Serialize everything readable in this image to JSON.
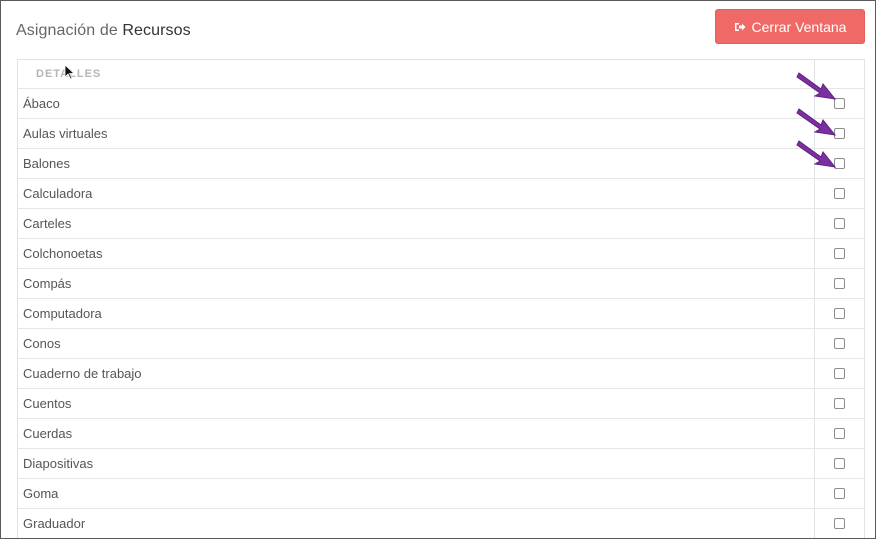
{
  "header": {
    "title_prefix": "Asignación de ",
    "title_strong": "Recursos"
  },
  "close_button": {
    "label": "Cerrar Ventana",
    "icon": "sign-out-icon"
  },
  "table": {
    "header_label": "DETALLES",
    "rows": [
      {
        "label": "Ábaco",
        "checked": false
      },
      {
        "label": "Aulas virtuales",
        "checked": false
      },
      {
        "label": "Balones",
        "checked": false
      },
      {
        "label": "Calculadora",
        "checked": false
      },
      {
        "label": "Carteles",
        "checked": false
      },
      {
        "label": "Colchonoetas",
        "checked": false
      },
      {
        "label": "Compás",
        "checked": false
      },
      {
        "label": "Computadora",
        "checked": false
      },
      {
        "label": "Conos",
        "checked": false
      },
      {
        "label": "Cuaderno de trabajo",
        "checked": false
      },
      {
        "label": "Cuentos",
        "checked": false
      },
      {
        "label": "Cuerdas",
        "checked": false
      },
      {
        "label": "Diapositivas",
        "checked": false
      },
      {
        "label": "Goma",
        "checked": false
      },
      {
        "label": "Graduador",
        "checked": false
      }
    ]
  },
  "colors": {
    "button": "#ef6a66",
    "annotation_arrow": "#7b2fa0"
  }
}
